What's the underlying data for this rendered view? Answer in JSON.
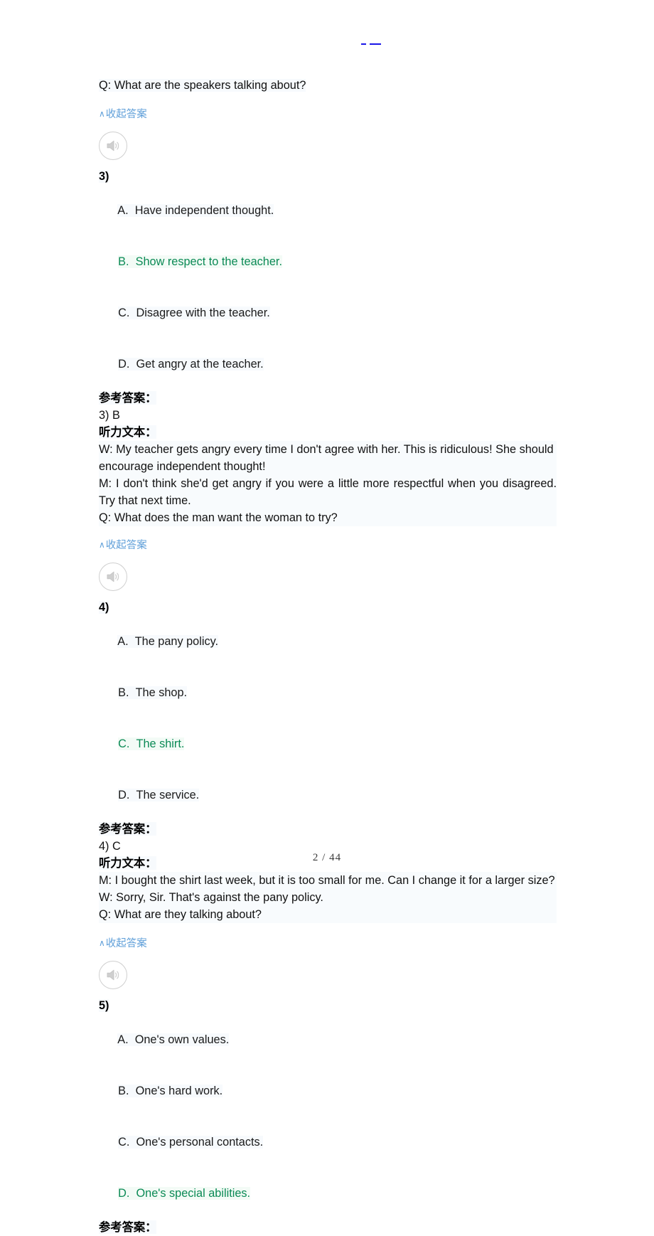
{
  "document": {
    "page_label": "2 / 44",
    "collapse_label": "收起答案",
    "collapse_caret": "∧",
    "reference_answer_label": "参考答案：",
    "transcript_label": "听力文本：",
    "audio_icon": "speaker-icon",
    "colors": {
      "correct_answer_green": "#0b8a55",
      "link_blue": "#5f9fd9",
      "text_black": "#111111",
      "top_mark_blue": "#1a16e8",
      "audio_border_gray": "#cfcfcf"
    }
  },
  "top_fragment": {
    "question_tail": "Q: What are the speakers talking about?"
  },
  "questions": [
    {
      "number": "3)",
      "options": [
        {
          "letter": "A.",
          "text": "Have independent thought.",
          "correct": false
        },
        {
          "letter": "B.",
          "text": "Show respect to the teacher.",
          "correct": true
        },
        {
          "letter": "C.",
          "text": "Disagree with the teacher.",
          "correct": false
        },
        {
          "letter": "D.",
          "text": "Get angry at the teacher.",
          "correct": false
        }
      ],
      "answer": "3) B",
      "transcript": [
        "W: My teacher gets angry every time I don't agree with her. This is ridiculous! She should encourage independent thought!",
        "M: I don't think she'd get angry if you were a little more respectful when you disagreed. Try that next time.",
        "Q: What does the man want the woman to try?"
      ]
    },
    {
      "number": "4)",
      "options": [
        {
          "letter": "A.",
          "text": "The pany policy.",
          "correct": false
        },
        {
          "letter": "B.",
          "text": "The shop.",
          "correct": false
        },
        {
          "letter": "C.",
          "text": "The shirt.",
          "correct": true
        },
        {
          "letter": "D.",
          "text": "The service.",
          "correct": false
        }
      ],
      "answer": "4) C",
      "transcript": [
        "M: I bought the shirt last week, but it is too small for me. Can I change it for a larger size?",
        "W: Sorry, Sir. That's against the pany policy.",
        "Q: What are they talking about?"
      ]
    },
    {
      "number": "5)",
      "options": [
        {
          "letter": "A.",
          "text": "One's own values.",
          "correct": false
        },
        {
          "letter": "B.",
          "text": "One's hard work.",
          "correct": false
        },
        {
          "letter": "C.",
          "text": "One's personal contacts.",
          "correct": false
        },
        {
          "letter": "D.",
          "text": "One's special abilities.",
          "correct": true
        }
      ],
      "answer": "",
      "transcript": []
    }
  ]
}
